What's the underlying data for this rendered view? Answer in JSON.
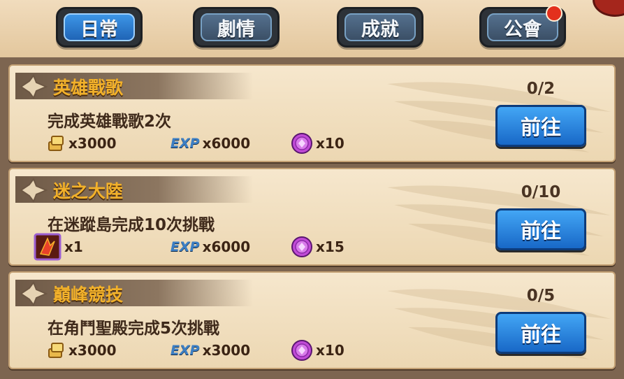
{
  "tabs": [
    {
      "label": "日常",
      "active": true
    },
    {
      "label": "劇情",
      "active": false
    },
    {
      "label": "成就",
      "active": false
    },
    {
      "label": "公會",
      "active": false,
      "notification": true
    }
  ],
  "quests": [
    {
      "title": "英雄戰歌",
      "progress": "0/2",
      "description": "完成英雄戰歌2次",
      "rewards": [
        {
          "icon": "gold-icon",
          "amount": "x3000"
        },
        {
          "icon": "exp-icon",
          "icon_label": "EXP",
          "amount": "x6000"
        },
        {
          "icon": "purple-medal-icon",
          "amount": "x10"
        }
      ],
      "button": "前往"
    },
    {
      "title": "迷之大陸",
      "progress": "0/10",
      "description": "在迷蹤島完成10次挑戰",
      "rewards": [
        {
          "icon": "red-rune-icon",
          "amount": "x1"
        },
        {
          "icon": "exp-icon",
          "icon_label": "EXP",
          "amount": "x6000"
        },
        {
          "icon": "purple-medal-icon",
          "amount": "x15"
        }
      ],
      "button": "前往"
    },
    {
      "title": "巔峰競技",
      "progress": "0/5",
      "description": "在角鬥聖殿完成5次挑戰",
      "rewards": [
        {
          "icon": "gold-icon",
          "amount": "x3000"
        },
        {
          "icon": "exp-icon",
          "icon_label": "EXP",
          "amount": "x3000"
        },
        {
          "icon": "purple-medal-icon",
          "amount": "x10"
        }
      ],
      "button": "前往"
    }
  ],
  "colors": {
    "title_gold": "#f2b12a",
    "button_blue": "#1868c7",
    "active_tab": "#1f64b6",
    "notification": "#e3301d"
  }
}
